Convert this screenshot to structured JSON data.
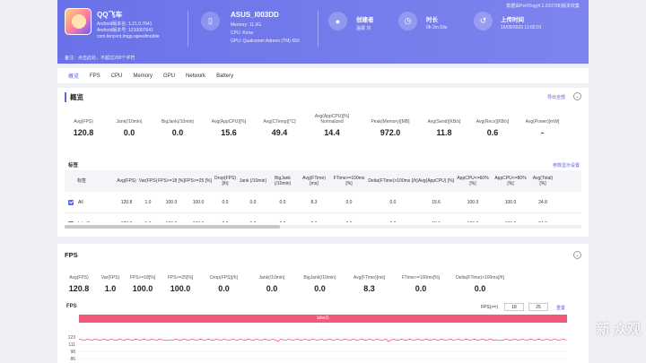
{
  "header": {
    "banner": "数据由PerfDog(4.1.200708)版本收集",
    "app": {
      "name": "QQ飞车",
      "android_code_version": "Android版本名: 1.21.0.7641",
      "android_version_code": "Android版本号: 1210007641",
      "package": "com.tencent.tmgp.speedmobile"
    },
    "device": {
      "name": "ASUS_I003DD",
      "memory": "Memory: 11.3G",
      "cpu": "CPU: Kona",
      "gpu": "GPU: Qualcomm Adreno (TM) 650"
    },
    "creator": {
      "title": "创建者",
      "value": "温振 刘"
    },
    "duration": {
      "title": "时长",
      "value": "0h 2m 59s"
    },
    "upload": {
      "title": "上传时间",
      "value": "16/09/2020 11:02:01"
    },
    "note": "备注：点击此处，不超过200个字符"
  },
  "tabs": [
    "概览",
    "FPS",
    "CPU",
    "Memory",
    "GPU",
    "Network",
    "Battery"
  ],
  "overview": {
    "title": "概览",
    "export_label": "导出全部",
    "stats": [
      {
        "label": "Avg(FPS)",
        "value": "120.8"
      },
      {
        "label": "Jank(/10min)",
        "value": "0.0"
      },
      {
        "label": "BigJank(/10min)",
        "value": "0.0"
      },
      {
        "label": "Avg(AppCPU)[%]",
        "value": "15.6"
      },
      {
        "label": "Avg(CTemp)[°C]",
        "value": "49.4"
      },
      {
        "label": "Avg(AppCPU)[%] Normalized",
        "value": "14.4"
      },
      {
        "label": "Peak(Memory)[MB]",
        "value": "972.0"
      },
      {
        "label": "Avg(Send)[KB/s]",
        "value": "11.8"
      },
      {
        "label": "Avg(Recv)[KB/s]",
        "value": "0.6"
      },
      {
        "label": "Avg(Power)[mW]",
        "value": "-"
      }
    ],
    "label_section": "标签",
    "show_settings": "参数显示设置",
    "table": {
      "headers": [
        "标签",
        "Avg(FPS)",
        "Var(FPS)",
        "FPS>=18 [%]",
        "FPS>=25 [%]",
        "Drop(FPS) [/h]",
        "Jank (/10min)",
        "BigJank (/10min)",
        "Avg(FTime) [ms]",
        "FTime>=100ms [%]",
        "Delta(FTime)>100ms [/h]",
        "Avg(AppCPU) [%]",
        "AppCPU<=60% [%]",
        "AppCPU<=80% [%]",
        "Avg(Total) [%]"
      ],
      "rows": [
        [
          "All",
          "120.8",
          "1.0",
          "100.0",
          "100.0",
          "0.0",
          "0.0",
          "0.0",
          "8.3",
          "0.0",
          "0.0",
          "15.6",
          "100.0",
          "100.0",
          "24.8"
        ],
        [
          "label1",
          "120.8",
          "1.0",
          "100.0",
          "100.0",
          "0.0",
          "0.0",
          "0.0",
          "8.3",
          "0.0",
          "0.0",
          "15.6",
          "100.0",
          "100.0",
          "24.8"
        ]
      ]
    }
  },
  "fps": {
    "title": "FPS",
    "stats": [
      {
        "label": "Avg(FPS)",
        "value": "120.8"
      },
      {
        "label": "Var(FPS)",
        "value": "1.0"
      },
      {
        "label": "FPS>=18[%]",
        "value": "100.0"
      },
      {
        "label": "FPS>=25[%]",
        "value": "100.0"
      },
      {
        "label": "Drop(FPS)[/h]",
        "value": "0.0"
      },
      {
        "label": "Jank(/10min)",
        "value": "0.0"
      },
      {
        "label": "BigJank(/10min)",
        "value": "0.0"
      },
      {
        "label": "Avg(FTime)[ms]",
        "value": "8.3"
      },
      {
        "label": "FTime>=100ms[%]",
        "value": "0.0"
      },
      {
        "label": "Delta(FTime)>100ms[/h]",
        "value": "0.0"
      }
    ],
    "chart_label": "FPS",
    "fps_threshold_label": "FPS(>=)",
    "threshold_1": "18",
    "threshold_2": "25",
    "reset_label": "重置",
    "chart_banner": "label1",
    "y_ticks": [
      "123",
      "111",
      "98",
      "86"
    ],
    "accent": "#f05a78"
  },
  "watermark": "新 众观",
  "colors": {
    "primary": "#6a72e8",
    "accent": "#5b63e6"
  }
}
